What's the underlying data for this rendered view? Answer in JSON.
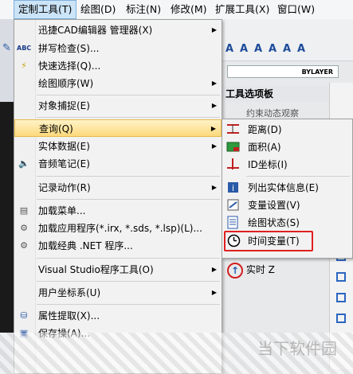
{
  "menubar": {
    "items": [
      {
        "label": "定制工具(T)",
        "active": true
      },
      {
        "label": "绘图(D)"
      },
      {
        "label": "标注(N)"
      },
      {
        "label": "修改(M)"
      },
      {
        "label": "扩展工具(X)"
      },
      {
        "label": "窗口(W)"
      }
    ]
  },
  "main_menu": {
    "items": [
      {
        "label": "迅捷CAD编辑器 管理器(X)",
        "icon": "none",
        "submenu": true
      },
      {
        "label": "拼写检查(S)...",
        "icon": "abc-spellcheck-icon"
      },
      {
        "label": "快速选择(Q)...",
        "icon": "quick-select-icon"
      },
      {
        "label": "绘图顺序(W)",
        "icon": "none",
        "submenu": true
      },
      {
        "label": "对象捕捉(E)",
        "icon": "none",
        "submenu": true
      },
      {
        "label": "查询(Q)",
        "icon": "none",
        "submenu": true,
        "highlighted": true
      },
      {
        "label": "实体数据(E)",
        "icon": "none",
        "submenu": true
      },
      {
        "label": "音频笔记(E)",
        "icon": "speaker-icon"
      },
      {
        "label": "记录动作(R)",
        "icon": "none",
        "submenu": true
      },
      {
        "label": "加载菜单...",
        "icon": "load-menu-icon"
      },
      {
        "label": "加载应用程序(*.irx, *.sds, *.lsp)(L)...",
        "icon": "load-app-icon"
      },
      {
        "label": "加载经典 .NET 程序...",
        "icon": "load-net-icon"
      },
      {
        "label": "Visual Studio程序工具(O)",
        "icon": "none",
        "submenu": true
      },
      {
        "label": "用户坐标系(U)",
        "icon": "none",
        "submenu": true
      },
      {
        "label": "属性提取(X)...",
        "icon": "attribute-extract-icon"
      },
      {
        "label": "保存操(A)...",
        "icon": "save-icon"
      }
    ]
  },
  "sub_menu": {
    "items": [
      {
        "label": "距离(D)",
        "icon": "distance-icon"
      },
      {
        "label": "面积(A)",
        "icon": "area-icon"
      },
      {
        "label": "ID坐标(I)",
        "icon": "id-coordinate-icon"
      },
      {
        "label": "列出实体信息(E)",
        "icon": "list-entity-icon"
      },
      {
        "label": "变量设置(V)",
        "icon": "variable-settings-icon"
      },
      {
        "label": "绘图状态(S)",
        "icon": "drawing-status-icon"
      },
      {
        "label": "时间变量(T)",
        "icon": "clock-icon",
        "highlighted": true
      }
    ]
  },
  "background": {
    "bylayer": "BYLAYER",
    "palette_title": "工具选项板",
    "palette_item": "约束动态观察",
    "realtime_z": "实时 Z",
    "watermark": "当下软件园"
  },
  "colors": {
    "highlight_fill": "#fcd97c",
    "red_outline": "#e02020",
    "menu_bg": "#f2f2f2"
  }
}
